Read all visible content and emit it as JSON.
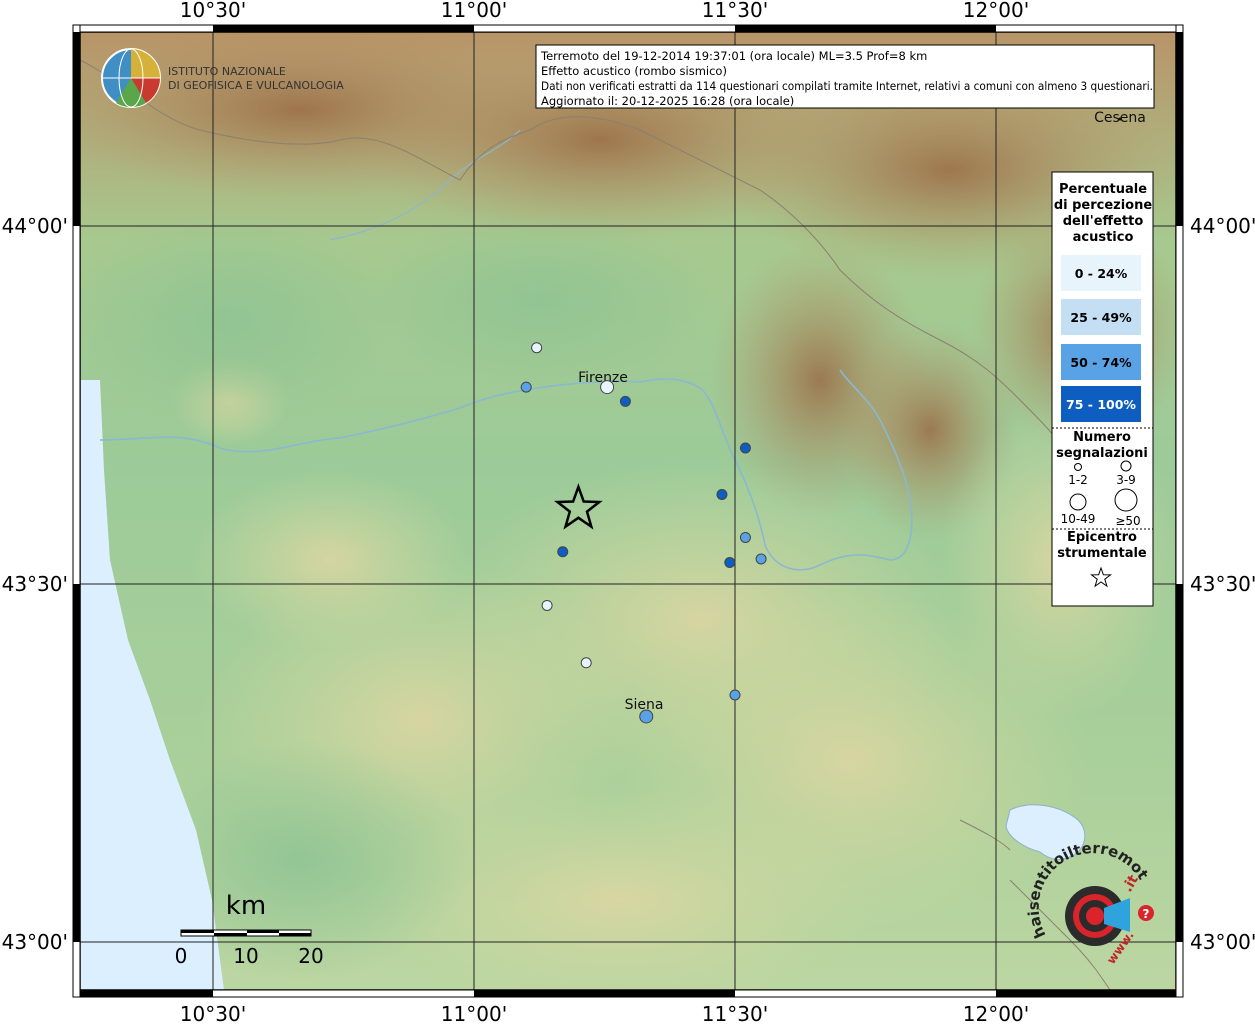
{
  "info_box": {
    "line1": "Terremoto del 19-12-2014 19:37:01 (ora locale) ML=3.5 Prof=8 km",
    "line2": "Effetto acustico (rombo sismico)",
    "line3": "Dati non verificati estratti da 114 questionari compilati tramite Internet, relativi a comuni con almeno 3 questionari.",
    "line4": "Aggiornato il: 20-12-2025 16:28 (ora locale)"
  },
  "logo": {
    "line1": "ISTITUTO NAZIONALE",
    "line2": "DI GEOFISICA E VULCANOLOGIA"
  },
  "axes": {
    "lon_ticks": [
      "10°30'",
      "11°00'",
      "11°30'",
      "12°00'"
    ],
    "lat_ticks": [
      "44°00'",
      "43°30'",
      "43°00'"
    ]
  },
  "places": {
    "firenze": "Firenze",
    "siena": "Siena",
    "cesena": "Cesena"
  },
  "legend": {
    "title_l1": "Percentuale",
    "title_l2": "di percezione",
    "title_l3": "dell'effetto",
    "title_l4": "acustico",
    "classes": [
      {
        "label": "0 - 24%",
        "fill": "#e8f4fc",
        "text": "#000000"
      },
      {
        "label": "25 - 49%",
        "fill": "#c4def4",
        "text": "#000000"
      },
      {
        "label": "50 - 74%",
        "fill": "#5aa2e6",
        "text": "#000000"
      },
      {
        "label": "75 - 100%",
        "fill": "#0d5ec0",
        "text": "#ffffff"
      }
    ],
    "count_l1": "Numero",
    "count_l2": "segnalazioni",
    "sizes": [
      "1-2",
      "3-9",
      "10-49",
      "≥50"
    ],
    "epi_l1": "Epicentro",
    "epi_l2": "strumentale"
  },
  "scale": {
    "unit": "km",
    "labels": [
      "0",
      "10",
      "20"
    ]
  },
  "haisentito": {
    "text": "haisentitoilterremoto",
    "domain": ".it",
    "www": "www."
  },
  "colors": {
    "sea": "#dcefff",
    "lowland": "#9cc99a",
    "mountain": "#b0906a"
  },
  "observations": [
    {
      "name": "obs-1",
      "lon": 11.12,
      "lat": 43.83,
      "class": 0
    },
    {
      "name": "obs-2",
      "lon": 11.1,
      "lat": 43.775,
      "class": 2
    },
    {
      "name": "obs-firenze",
      "lon": 11.255,
      "lat": 43.775,
      "class": 0,
      "big": true
    },
    {
      "name": "obs-3",
      "lon": 11.29,
      "lat": 43.755,
      "class": 3
    },
    {
      "name": "obs-4",
      "lon": 11.52,
      "lat": 43.69,
      "class": 3
    },
    {
      "name": "obs-5",
      "lon": 11.475,
      "lat": 43.625,
      "class": 3
    },
    {
      "name": "obs-6",
      "lon": 11.52,
      "lat": 43.565,
      "class": 2
    },
    {
      "name": "obs-7",
      "lon": 11.55,
      "lat": 43.535,
      "class": 2
    },
    {
      "name": "obs-8",
      "lon": 11.17,
      "lat": 43.545,
      "class": 3
    },
    {
      "name": "obs-9",
      "lon": 11.49,
      "lat": 43.53,
      "class": 3
    },
    {
      "name": "obs-10",
      "lon": 11.14,
      "lat": 43.47,
      "class": 0
    },
    {
      "name": "obs-11",
      "lon": 11.215,
      "lat": 43.39,
      "class": 0
    },
    {
      "name": "obs-12",
      "lon": 11.5,
      "lat": 43.345,
      "class": 2
    },
    {
      "name": "obs-siena",
      "lon": 11.33,
      "lat": 43.315,
      "class": 2,
      "big": true
    }
  ],
  "epicenter": {
    "lon": 11.2,
    "lat": 43.605
  }
}
